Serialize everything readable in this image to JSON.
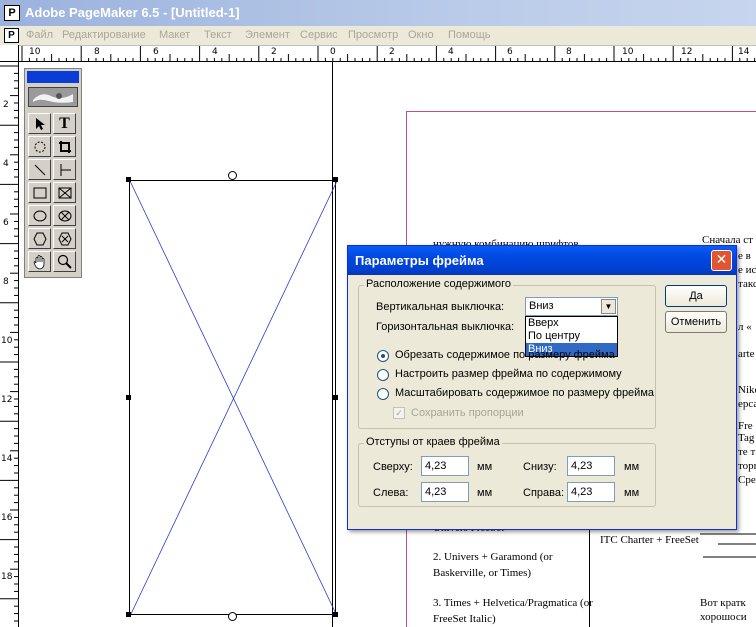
{
  "window": {
    "title": "Adobe PageMaker 6.5 - [Untitled-1]",
    "app_icon": "P",
    "doc_icon": "P"
  },
  "menu": [
    "Файл",
    "Редактирование",
    "Макет",
    "Текст",
    "Элемент",
    "Сервис",
    "Просмотр",
    "Окно",
    "Помощь"
  ],
  "hruler_labels": [
    "10",
    "8",
    "6",
    "4",
    "2",
    "0",
    "2",
    "4",
    "6",
    "8",
    "10",
    "12",
    "14"
  ],
  "vruler_labels": [
    "2",
    "4",
    "6",
    "8",
    "10",
    "12",
    "14",
    "16",
    "18"
  ],
  "toolbox": {
    "tools": [
      "pointer-tool",
      "text-tool",
      "rotate-tool",
      "crop-tool",
      "line-tool",
      "constrained-line-tool",
      "rectangle-tool",
      "rectangle-frame-tool",
      "ellipse-tool",
      "ellipse-frame-tool",
      "polygon-tool",
      "polygon-frame-tool",
      "hand-tool",
      "zoom-tool"
    ],
    "text_tool_glyph": "T"
  },
  "document": {
    "col1_top": "нужную комбинацию шрифтов",
    "col1_bottom_1": "2. Univers + Garamond (or",
    "col1_bottom_2": "Baskerville, or  Times)",
    "col1_bottom_3": "3. Times + Helvetica/Pragmatica (or",
    "col1_bottom_4": "FreeSet Italic)",
    "col1_cut": "Univers  FreeSet",
    "col2_line1": "Сначала  ст",
    "col2_line2": "e  в",
    "col2_line3": "е  ис",
    "col2_line4": "такс",
    "col2_line5": "л «",
    "col2_line6": "arte",
    "col2_line7": "Niko",
    "col2_line8": "ерса",
    "col2_line9": "Fre",
    "col2_line10": "Tag",
    "col2_line11": "те  т",
    "col2_line12": "торг",
    "col2_line13": "Срея",
    "col2_charter": "ITC Charter + FreeSet",
    "col2_last1": "Вот кратк",
    "col2_last2": "хорошоси"
  },
  "dialog": {
    "title": "Параметры фрейма",
    "close_glyph": "✕",
    "content_group_label": "Расположение содержимого",
    "vertical_label": "Вертикальная выключка:",
    "vertical_value": "Вниз",
    "horizontal_label": "Горизонтальная выключка:",
    "dropdown_options": [
      "Вверх",
      "По центру",
      "Вниз"
    ],
    "radio_clip": "Обрезать содержимое по размеру фрейма",
    "radio_fit": "Настроить размер фрейма по содержимому",
    "radio_scale": "Масштабировать содержимое по размеру фрейма",
    "keep_proportions": "Сохранить пропорции",
    "insets_group_label": "Отступы от краев фрейма",
    "top_label": "Сверху:",
    "top_value": "4,23",
    "bottom_label": "Снизу:",
    "bottom_value": "4,23",
    "left_label": "Слева:",
    "left_value": "4,23",
    "right_label": "Справа:",
    "right_value": "4,23",
    "unit": "мм",
    "ok_label": "Да",
    "cancel_label": "Отменить"
  }
}
